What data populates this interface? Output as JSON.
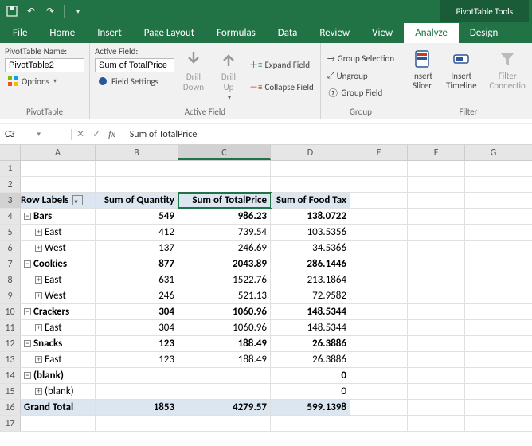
{
  "titlebar": {
    "context_tools": "PivotTable Tools"
  },
  "tabs": {
    "file": "File",
    "home": "Home",
    "insert": "Insert",
    "page_layout": "Page Layout",
    "formulas": "Formulas",
    "data": "Data",
    "review": "Review",
    "view": "View",
    "analyze": "Analyze",
    "design": "Design"
  },
  "ribbon": {
    "pivottable": {
      "name_label": "PivotTable Name:",
      "name_value": "PivotTable2",
      "options": "Options",
      "group_label": "PivotTable"
    },
    "activefield": {
      "label": "Active Field:",
      "value": "Sum of TotalPrice",
      "field_settings": "Field Settings",
      "drill_down": "Drill Down",
      "drill_up": "Drill Up",
      "expand": "Expand Field",
      "collapse": "Collapse Field",
      "group_label": "Active Field"
    },
    "group": {
      "selection": "Group Selection",
      "ungroup": "Ungroup",
      "field": "Group Field",
      "group_label": "Group"
    },
    "filter": {
      "slicer": "Insert Slicer",
      "timeline": "Insert Timeline",
      "connections": "Filter Connectio",
      "group_label": "Filter"
    }
  },
  "fxbar": {
    "cell_ref": "C3",
    "formula": "Sum of TotalPrice"
  },
  "columns": [
    "",
    "A",
    "B",
    "C",
    "D",
    "E",
    "F",
    "G"
  ],
  "pivot": {
    "headers": {
      "row_labels": "Row Labels",
      "qty": "Sum of Quantity",
      "total": "Sum of TotalPrice",
      "tax": "Sum of Food Tax"
    },
    "rows": [
      {
        "n": 4,
        "type": "cat",
        "label": "Bars",
        "qty": "549",
        "total": "986.23",
        "tax": "138.0722"
      },
      {
        "n": 5,
        "type": "sub",
        "label": "East",
        "qty": "412",
        "total": "739.54",
        "tax": "103.5356"
      },
      {
        "n": 6,
        "type": "sub",
        "label": "West",
        "qty": "137",
        "total": "246.69",
        "tax": "34.5366"
      },
      {
        "n": 7,
        "type": "cat",
        "label": "Cookies",
        "qty": "877",
        "total": "2043.89",
        "tax": "286.1446"
      },
      {
        "n": 8,
        "type": "sub",
        "label": "East",
        "qty": "631",
        "total": "1522.76",
        "tax": "213.1864"
      },
      {
        "n": 9,
        "type": "sub",
        "label": "West",
        "qty": "246",
        "total": "521.13",
        "tax": "72.9582"
      },
      {
        "n": 10,
        "type": "cat",
        "label": "Crackers",
        "qty": "304",
        "total": "1060.96",
        "tax": "148.5344"
      },
      {
        "n": 11,
        "type": "sub",
        "label": "East",
        "qty": "304",
        "total": "1060.96",
        "tax": "148.5344"
      },
      {
        "n": 12,
        "type": "cat",
        "label": "Snacks",
        "qty": "123",
        "total": "188.49",
        "tax": "26.3886"
      },
      {
        "n": 13,
        "type": "sub",
        "label": "East",
        "qty": "123",
        "total": "188.49",
        "tax": "26.3886"
      },
      {
        "n": 14,
        "type": "cat",
        "label": "(blank)",
        "qty": "",
        "total": "",
        "tax": "0"
      },
      {
        "n": 15,
        "type": "sub",
        "label": "(blank)",
        "qty": "",
        "total": "",
        "tax": "0"
      }
    ],
    "grand": {
      "label": "Grand Total",
      "qty": "1853",
      "total": "4279.57",
      "tax": "599.1398"
    }
  }
}
